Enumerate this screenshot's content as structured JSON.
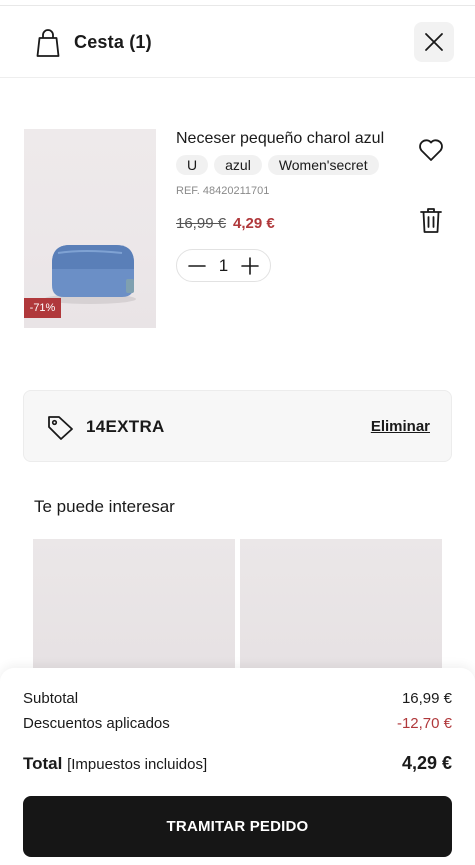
{
  "header": {
    "title": "Cesta (1)",
    "icon": "shopping-bag-icon",
    "close_icon": "close-icon"
  },
  "product": {
    "name": "Neceser pequeño charol azul",
    "attributes": [
      "U",
      "azul",
      "Women'secret"
    ],
    "ref": "REF. 48420211701",
    "price_original": "16,99 €",
    "price_current": "4,29 €",
    "discount_badge": "-71%",
    "quantity": "1",
    "image": "blue-patent-cosmetic-bag"
  },
  "coupon": {
    "code": "14EXTRA",
    "remove_label": "Eliminar",
    "icon": "tag-icon"
  },
  "recommendations": {
    "title": "Te puede interesar"
  },
  "summary": {
    "subtotal_label": "Subtotal",
    "subtotal_value": "16,99 €",
    "discounts_label": "Descuentos aplicados",
    "discounts_value": "-12,70 €",
    "total_label": "Total",
    "total_note": "[Impuestos incluidos]",
    "total_value": "4,29 €",
    "checkout_label": "TRAMITAR PEDIDO"
  },
  "colors": {
    "accent_red": "#b0383b",
    "button_dark": "#161616",
    "chip_bg": "#f1f1f1"
  }
}
